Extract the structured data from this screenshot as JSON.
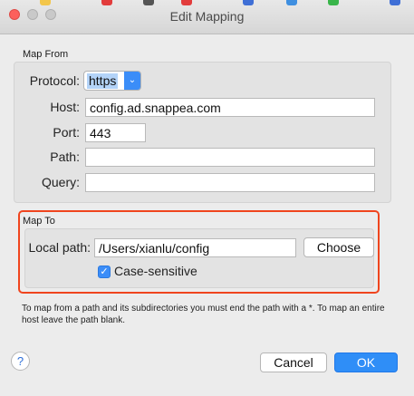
{
  "window": {
    "title": "Edit Mapping"
  },
  "map_from": {
    "label": "Map From",
    "protocol_label": "Protocol:",
    "protocol_value": "https",
    "host_label": "Host:",
    "host_value": "config.ad.snappea.com",
    "port_label": "Port:",
    "port_value": "443",
    "path_label": "Path:",
    "path_value": "",
    "query_label": "Query:",
    "query_value": ""
  },
  "map_to": {
    "label": "Map To",
    "local_path_label": "Local path:",
    "local_path_value": "/Users/xianlu/config",
    "choose_label": "Choose",
    "case_sensitive_label": "Case-sensitive",
    "case_sensitive_checked": true
  },
  "help_text": "To map from a path and its subdirectories you must end the path with a *. To map an entire host leave the path blank.",
  "buttons": {
    "help": "?",
    "cancel": "Cancel",
    "ok": "OK"
  },
  "colors": {
    "accent": "#3b8df8",
    "highlight": "#f0451e"
  }
}
